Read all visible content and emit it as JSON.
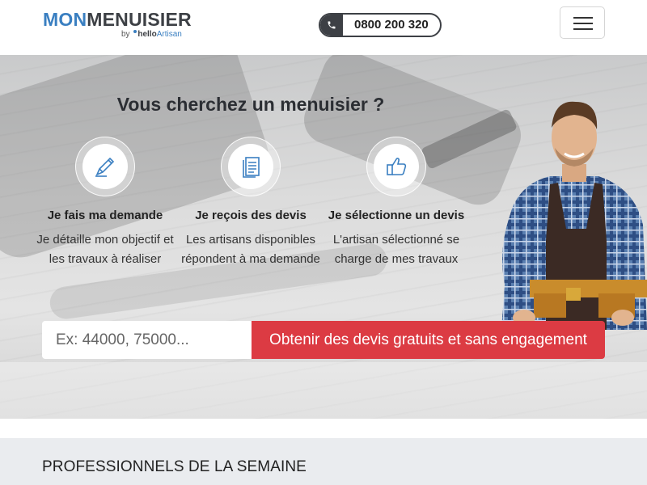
{
  "header": {
    "logo": {
      "mon": "MON",
      "menuisier": "MENUISIER",
      "by": "by",
      "hello": "hello",
      "artisan": "Artisan"
    },
    "phone": "0800 200 320"
  },
  "hero": {
    "title": "Vous cherchez un menuisier ?",
    "steps": [
      {
        "title": "Je fais ma demande",
        "desc": "Je détaille mon objectif et les travaux à réaliser",
        "icon": "pencil-icon"
      },
      {
        "title": "Je reçois des devis",
        "desc": "Les artisans disponibles répondent à ma demande",
        "icon": "document-icon"
      },
      {
        "title": "Je sélectionne un devis",
        "desc": "L'artisan sélectionné se charge de mes travaux",
        "icon": "thumbs-up-icon"
      }
    ],
    "search": {
      "placeholder": "Ex: 44000, 75000...",
      "button": "Obtenir des devis gratuits et sans engagement"
    }
  },
  "section": {
    "title": "PROFESSIONNELS DE LA SEMAINE"
  },
  "colors": {
    "accent": "#dc3b43",
    "brand_blue": "#3a7fc1",
    "dark": "#3d4045"
  }
}
